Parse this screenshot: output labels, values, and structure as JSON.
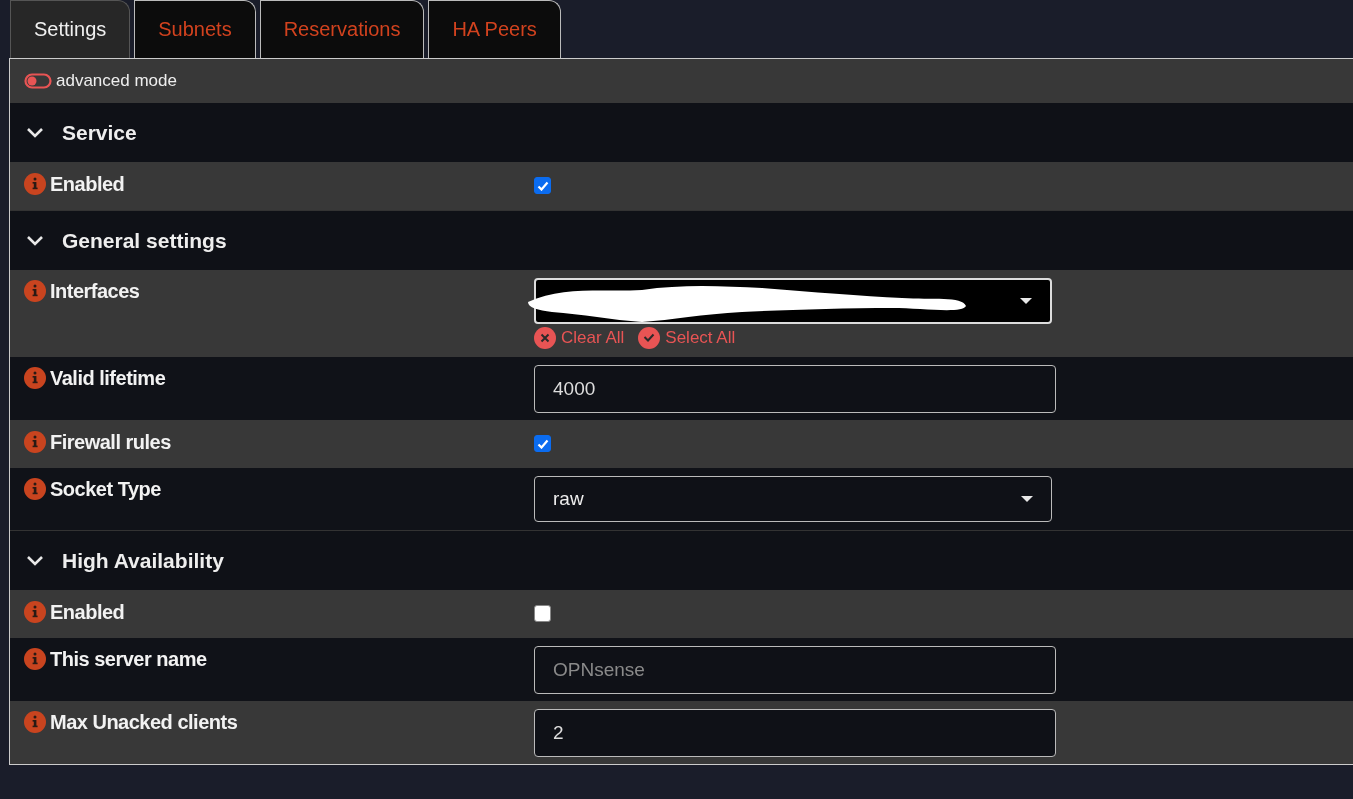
{
  "tabs": [
    {
      "label": "Settings",
      "selected": true
    },
    {
      "label": "Subnets",
      "selected": false
    },
    {
      "label": "Reservations",
      "selected": false
    },
    {
      "label": "HA Peers",
      "selected": false
    }
  ],
  "advanced_mode": {
    "label": "advanced mode",
    "on": false
  },
  "sections": [
    {
      "title": "Service",
      "expanded": true,
      "rows": [
        {
          "kind": "checkbox",
          "label": "Enabled",
          "checked": true
        }
      ]
    },
    {
      "title": "General settings",
      "expanded": true,
      "rows": [
        {
          "kind": "multiselect",
          "label": "Interfaces",
          "actions": [
            {
              "kind": "clear",
              "label": "Clear All"
            },
            {
              "kind": "select",
              "label": "Select All"
            }
          ]
        },
        {
          "kind": "input",
          "label": "Valid lifetime",
          "value": "4000"
        },
        {
          "kind": "checkbox",
          "label": "Firewall rules",
          "checked": true
        },
        {
          "kind": "select",
          "label": "Socket Type",
          "value": "raw"
        }
      ]
    },
    {
      "title": "High Availability",
      "expanded": true,
      "rows": [
        {
          "kind": "checkbox",
          "label": "Enabled",
          "checked": false
        },
        {
          "kind": "input",
          "label": "This server name",
          "placeholder": "OPNsense"
        },
        {
          "kind": "input",
          "label": "Max Unacked clients",
          "value": "2"
        }
      ]
    }
  ]
}
